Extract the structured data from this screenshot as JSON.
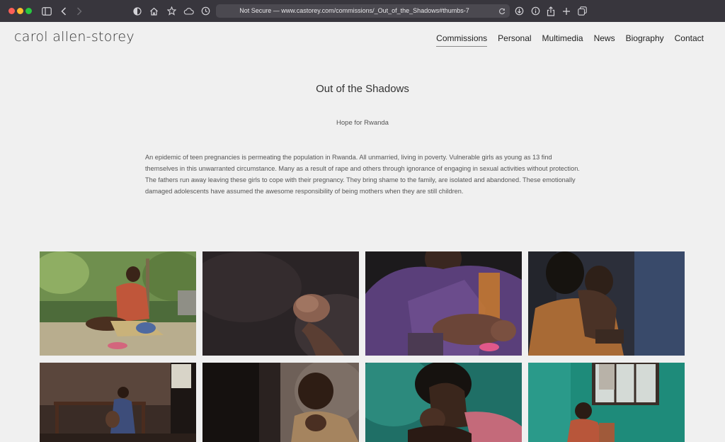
{
  "browser": {
    "url": "Not Secure — www.castorey.com/commissions/_Out_of_the_Shadows#thumbs-7",
    "icons": [
      "sidebar-icon",
      "back-icon",
      "forward-icon",
      "shield-icon",
      "home-icon",
      "star-icon",
      "cloud-icon",
      "history-icon",
      "reload-icon",
      "download-icon",
      "info-icon",
      "share-icon",
      "new-tab-icon",
      "tabs-icon"
    ]
  },
  "site": {
    "logo": "carol allen-storey",
    "nav": [
      {
        "label": "Commissions",
        "active": true
      },
      {
        "label": "Personal"
      },
      {
        "label": "Multimedia"
      },
      {
        "label": "News"
      },
      {
        "label": "Biography"
      },
      {
        "label": "Contact"
      }
    ]
  },
  "gallery": {
    "title": "Out of the Shadows",
    "subtitle": "Hope for Rwanda",
    "description": "An epidemic of teen pregnancies is permeating the population in Rwanda. All unmarried, living in poverty. Vulnerable girls as young as 13 find themselves in this unwarranted circumstance. Many as a result of rape and others through ignorance of engaging in sexual activities without protection. The fathers run away leaving these girls to cope with their pregnancy. They bring shame to the family, are isolated and abandoned. These emotionally damaged adolescents have assumed the awesome responsibility of being mothers when they are still children.",
    "thumbnails": [
      {
        "name": "mother-with-baby-outdoors"
      },
      {
        "name": "baby-fist"
      },
      {
        "name": "mother-breastfeeding"
      },
      {
        "name": "girl-holding-child"
      },
      {
        "name": "mother-on-bench"
      },
      {
        "name": "boy-in-doorway"
      },
      {
        "name": "girl-head-in-hand"
      },
      {
        "name": "woman-by-window"
      }
    ]
  },
  "colors": {
    "page_bg": "#f0f0f0",
    "toolbar_bg": "#38363d",
    "text": "#333333"
  }
}
